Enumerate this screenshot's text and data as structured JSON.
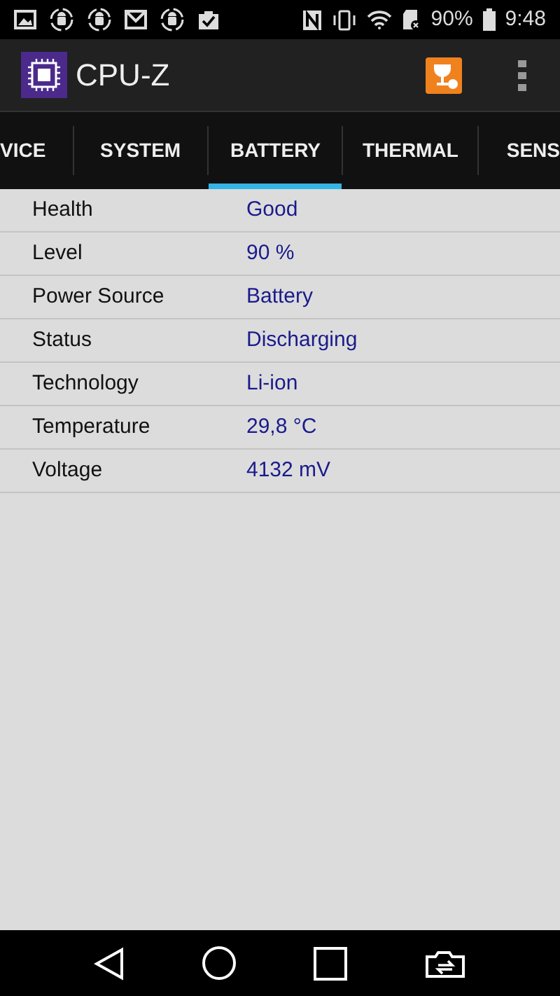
{
  "status_bar": {
    "battery_percent": "90%",
    "time": "9:48"
  },
  "app_bar": {
    "title": "CPU-Z"
  },
  "tabs": [
    {
      "label": "VICE",
      "selected": false
    },
    {
      "label": "SYSTEM",
      "selected": false
    },
    {
      "label": "BATTERY",
      "selected": true
    },
    {
      "label": "THERMAL",
      "selected": false
    },
    {
      "label": "SENS",
      "selected": false
    }
  ],
  "rows": [
    {
      "label": "Health",
      "value": "Good"
    },
    {
      "label": "Level",
      "value": "90 %"
    },
    {
      "label": "Power Source",
      "value": "Battery"
    },
    {
      "label": "Status",
      "value": "Discharging"
    },
    {
      "label": "Technology",
      "value": "Li-ion"
    },
    {
      "label": "Temperature",
      "value": "29,8 °C"
    },
    {
      "label": "Voltage",
      "value": "4132 mV"
    }
  ]
}
